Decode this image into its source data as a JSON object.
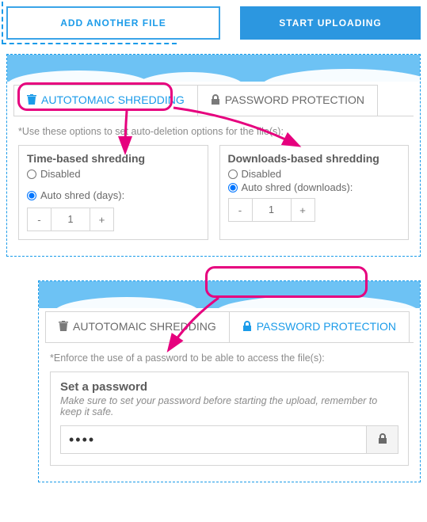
{
  "top": {
    "add_label": "ADD ANOTHER FILE",
    "upload_label": "START UPLOADING"
  },
  "tabs": {
    "shredding": "AUTOTOMAIC SHREDDING",
    "password": "PASSWORD PROTECTION"
  },
  "shredding": {
    "caption": "Use these options to set auto-deletion options for the file(s):",
    "time": {
      "title": "Time-based shredding",
      "opt_disabled": "Disabled",
      "opt_auto": "Auto shred (days):",
      "value": "1"
    },
    "dl": {
      "title": "Downloads-based shredding",
      "opt_disabled": "Disabled",
      "opt_auto": "Auto shred (downloads):",
      "value": "1"
    },
    "minus": "-",
    "plus": "+"
  },
  "password": {
    "caption": "Enforce the use of a password to be able to access the file(s):",
    "title": "Set a password",
    "hint": "Make sure to set your password before starting the upload, remember to keep it safe.",
    "value": "....",
    "placeholder": ""
  }
}
